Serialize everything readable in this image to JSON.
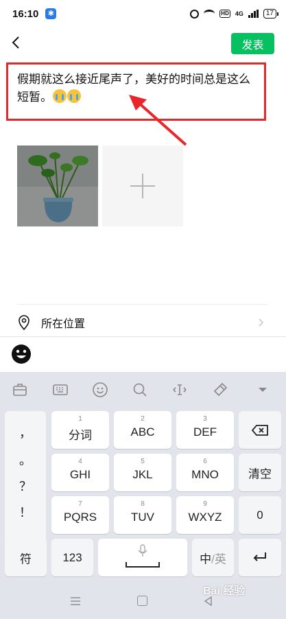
{
  "status_bar": {
    "time": "16:10",
    "hd_label": "HD",
    "network_label": "4G",
    "battery": "17"
  },
  "header": {
    "publish_label": "发表"
  },
  "post": {
    "text": "假期就这么接近尾声了，美好的时间总是这么短暂。"
  },
  "options": {
    "location_label": "所在位置"
  },
  "keyboard": {
    "punctuation": [
      "，",
      "。",
      "？",
      "！"
    ],
    "rows": [
      [
        {
          "num": "1",
          "label": "分词"
        },
        {
          "num": "2",
          "label": "ABC"
        },
        {
          "num": "3",
          "label": "DEF"
        }
      ],
      [
        {
          "num": "4",
          "label": "GHI"
        },
        {
          "num": "5",
          "label": "JKL"
        },
        {
          "num": "6",
          "label": "MNO"
        }
      ],
      [
        {
          "num": "7",
          "label": "PQRS"
        },
        {
          "num": "8",
          "label": "TUV"
        },
        {
          "num": "9",
          "label": "WXYZ"
        }
      ]
    ],
    "clear_label": "清空",
    "zero_label": "0",
    "symbol_label": "符",
    "number_mode_label": "123",
    "lang_active": "中",
    "lang_separator": "/",
    "lang_inactive": "英"
  },
  "watermark": "Bai 经验",
  "colors": {
    "accent_green": "#07c160",
    "annotation_red": "#e8272b",
    "keyboard_bg": "#e1e4ea"
  },
  "icons": [
    "back-icon",
    "location-pin-icon",
    "chevron-right-icon",
    "emoji-face-icon",
    "backspace-icon",
    "microphone-icon",
    "enter-icon"
  ]
}
